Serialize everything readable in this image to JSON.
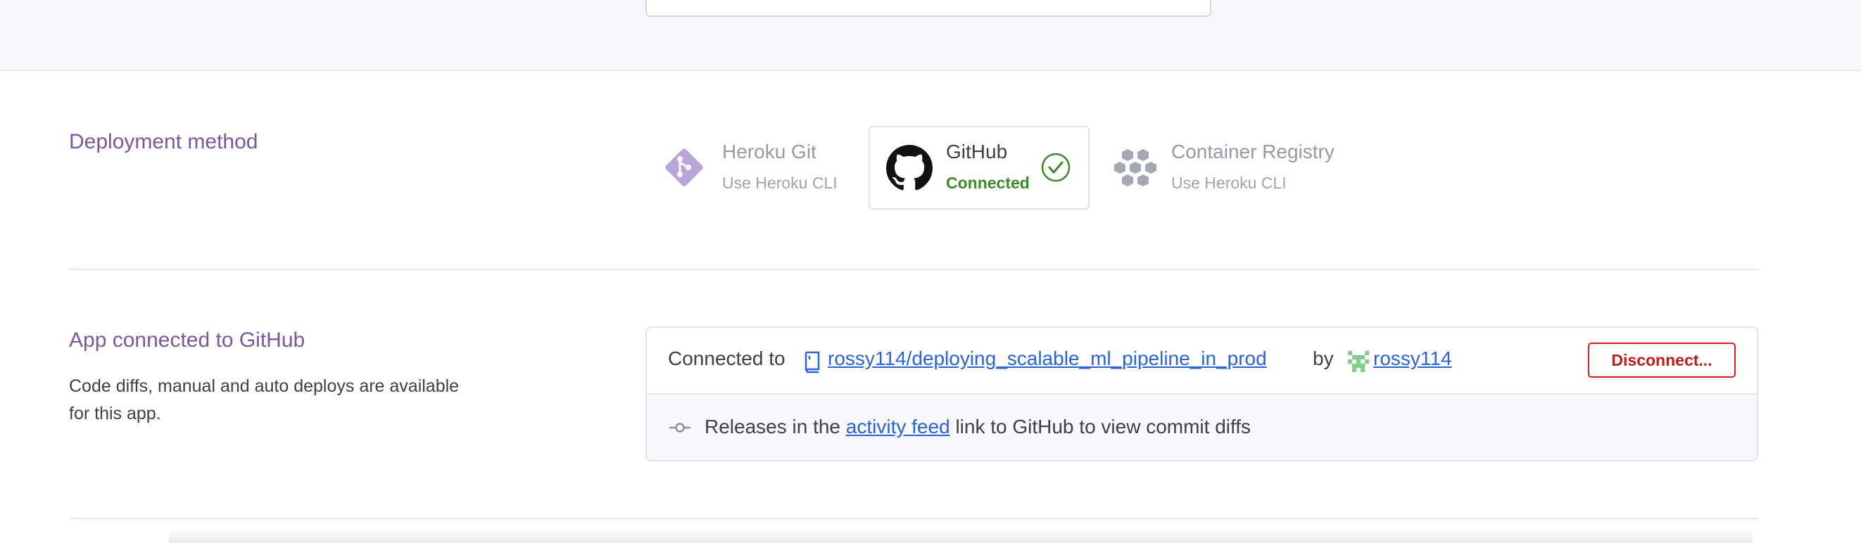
{
  "deployment": {
    "section_title": "Deployment method",
    "methods": [
      {
        "name": "Heroku Git",
        "sub": "Use Heroku CLI",
        "icon": "heroku-git-icon",
        "color": "#b9a5d6"
      },
      {
        "name": "GitHub",
        "sub": "Connected",
        "icon": "github-icon",
        "status_color": "#3d8a2b",
        "selected": true
      },
      {
        "name": "Container Registry",
        "sub": "Use Heroku CLI",
        "icon": "container-registry-icon",
        "color": "#a4a7b4"
      }
    ]
  },
  "github_connection": {
    "section_title": "App connected to GitHub",
    "description": "Code diffs, manual and auto deploys are available for this app.",
    "connected_to_label": "Connected to",
    "repo": "rossy114/deploying_scalable_ml_pipeline_in_prod",
    "by_label": "by",
    "user": "rossy114",
    "disconnect_label": "Disconnect...",
    "releases_prefix": "Releases in the",
    "activity_feed_link": "activity feed",
    "releases_suffix": "link to GitHub to view commit diffs"
  }
}
